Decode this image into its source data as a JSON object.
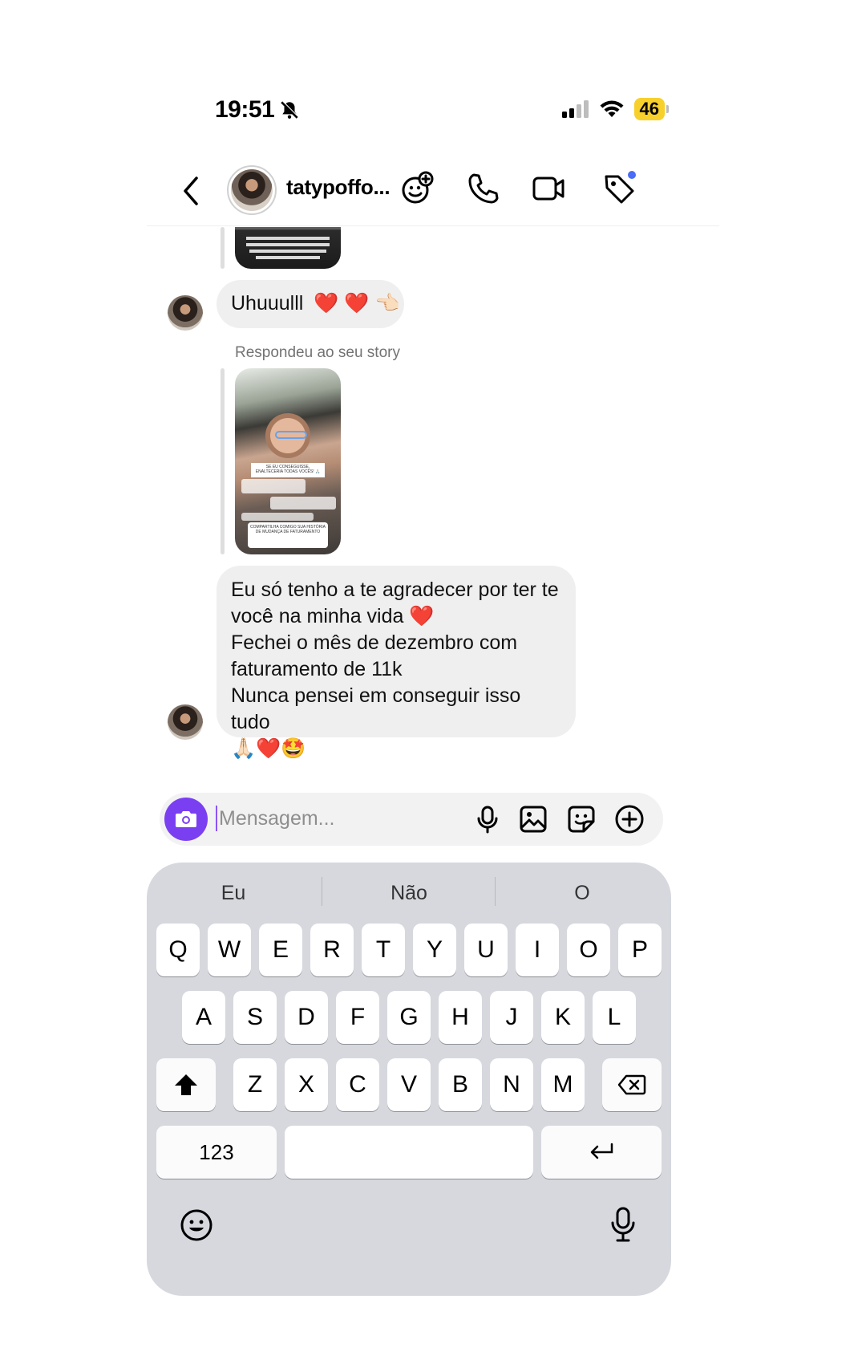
{
  "status_bar": {
    "time": "19:51",
    "battery": "46"
  },
  "header": {
    "username": "tatypoffo..."
  },
  "chat": {
    "message1": {
      "text": "Uhuuulll",
      "emojis": "❤️ ❤️ 👈🏻"
    },
    "reply_label": "Respondeu ao seu story",
    "message2": {
      "line1": "Eu só tenho a te agradecer por ter te",
      "line2": "você na minha vida",
      "line3": "Fechei o mês de dezembro com",
      "line4": "faturamento de 11k",
      "line5": "Nunca pensei em conseguir isso tudo",
      "line6": "🙏🏻❤️🤩"
    },
    "story_texts": {
      "t1": "SE EU CONSEGUISSE, ENALTECERIA TODAS VOCÊS! 🙏🏻",
      "t2": "COMPARTILHA COMIGO SUA HISTÓRIA DE MUDANÇA DE FATURAMENTO"
    }
  },
  "input": {
    "placeholder": "Mensagem..."
  },
  "keyboard": {
    "suggestions": [
      "Eu",
      "Não",
      "O"
    ],
    "row1": [
      "Q",
      "W",
      "E",
      "R",
      "T",
      "Y",
      "U",
      "I",
      "O",
      "P"
    ],
    "row2": [
      "A",
      "S",
      "D",
      "F",
      "G",
      "H",
      "J",
      "K",
      "L"
    ],
    "row3": [
      "Z",
      "X",
      "C",
      "V",
      "B",
      "N",
      "M"
    ],
    "numbers_key": "123"
  },
  "colors": {
    "accent": "#7b3ff2",
    "bubble": "#efefef",
    "keyboard_bg": "#d6d8de",
    "notification_dot": "#4a6cf7"
  }
}
